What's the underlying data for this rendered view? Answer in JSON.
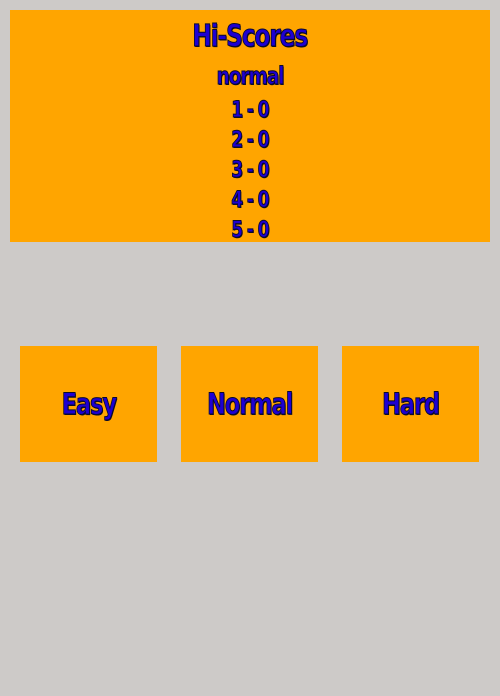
{
  "hiscores": {
    "title": "Hi-Scores",
    "difficulty": "normal",
    "entries": [
      {
        "text": "1 - 0"
      },
      {
        "text": "2 - 0"
      },
      {
        "text": "3 - 0"
      },
      {
        "text": "4 - 0"
      },
      {
        "text": "5 - 0"
      }
    ]
  },
  "menu": {
    "easy_label": "Easy",
    "normal_label": "Normal",
    "hard_label": "Hard"
  },
  "colors": {
    "panel_background": "#ffa500",
    "page_background": "#cdcac8",
    "text": "#1e00d2"
  }
}
